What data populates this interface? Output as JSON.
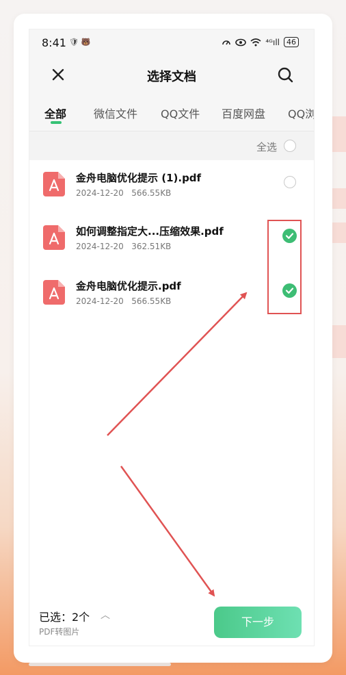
{
  "status_bar": {
    "time": "8:41",
    "left_icons": "🛡 🐻",
    "signal": "⁴ᴳıll",
    "battery": "46"
  },
  "header": {
    "title": "选择文档"
  },
  "tabs": [
    {
      "label": "全部",
      "active": true
    },
    {
      "label": "微信文件",
      "active": false
    },
    {
      "label": "QQ文件",
      "active": false
    },
    {
      "label": "百度网盘",
      "active": false
    },
    {
      "label": "QQ浏",
      "active": false
    }
  ],
  "select_all": {
    "label": "全选"
  },
  "files": [
    {
      "name": "金舟电脑优化提示 (1).pdf",
      "date": "2024-12-20",
      "size": "566.55KB",
      "checked": false
    },
    {
      "name": "如何调整指定大...压缩效果.pdf",
      "date": "2024-12-20",
      "size": "362.51KB",
      "checked": true
    },
    {
      "name": "金舟电脑优化提示.pdf",
      "date": "2024-12-20",
      "size": "566.55KB",
      "checked": true
    }
  ],
  "footer": {
    "selected": "已选：2个",
    "sub_label": "PDF转图片",
    "next_button": "下一步"
  },
  "colors": {
    "accent": "#3dbd74",
    "annotation": "#e05353",
    "pdf": "#ef6b6b"
  }
}
